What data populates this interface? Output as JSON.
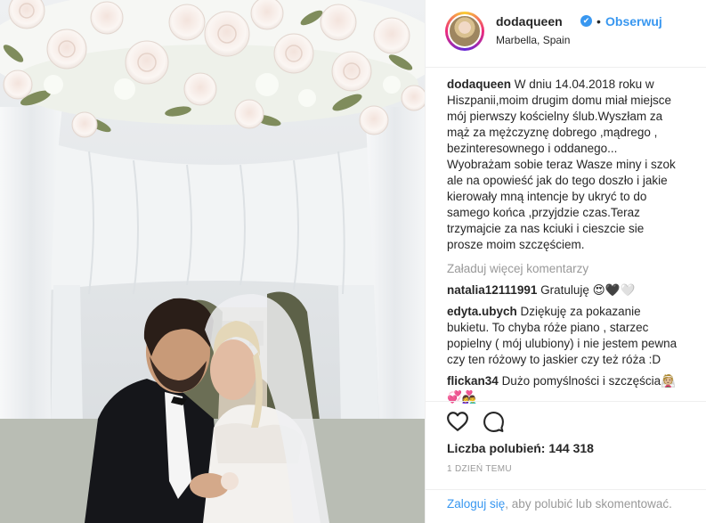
{
  "header": {
    "username": "dodaqueen",
    "verified_icon": "✔",
    "separator": "•",
    "follow_label": "Obserwuj",
    "location": "Marbella, Spain"
  },
  "caption": {
    "username": "dodaqueen",
    "text": "W dniu 14.04.2018 roku w Hiszpanii,moim drugim domu miał miejsce mój pierwszy kościelny ślub.Wyszłam za mąż za mężczyznę dobrego ,mądrego , bezinteresownego i oddanego... Wyobrażam sobie teraz Wasze miny i szok ale na opowieść jak do tego doszło i jakie kierowały mną intencje by ukryć to do samego końca ,przyjdzie czas.Teraz trzymajcie za nas kciuki i cieszcie sie prosze moim szczęściem."
  },
  "load_more_label": "Załaduj więcej komentarzy",
  "comments": [
    {
      "username": "natalia12111991",
      "text": "Gratuluję 😍🖤🤍"
    },
    {
      "username": "edyta.ubych",
      "text": "Dziękuję za pokazanie bukietu. To chyba róże piano , starzec popielny ( mój ulubiony) i nie jestem pewna czy ten różowy to jaskier czy też róża :D"
    },
    {
      "username": "flickan34",
      "text": "Dużo pomyślności i szczęścia👰🏼💞👩‍❤️‍👨"
    }
  ],
  "likes": {
    "label": "Liczba polubień:",
    "count": "144 318"
  },
  "timestamp": "1 DZIEŃ TEMU",
  "footer": {
    "login_label": "Zaloguj się",
    "rest": ", aby polubić lub skomentować."
  },
  "colors": {
    "accent": "#3897f0",
    "muted": "#999999",
    "text": "#262626",
    "border": "#efefef"
  },
  "icons": [
    "heart-icon",
    "comment-icon",
    "verified-badge-icon"
  ]
}
